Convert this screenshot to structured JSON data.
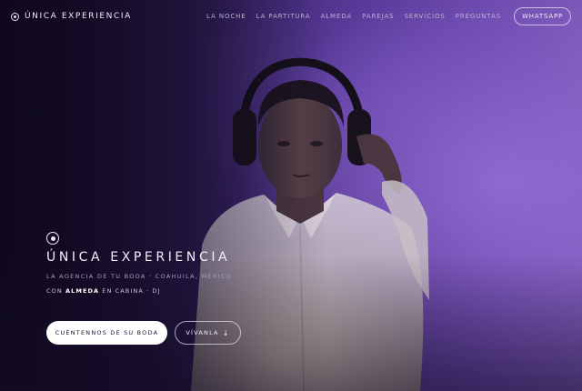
{
  "brand": {
    "name": "ÚNICA EXPERIENCIA",
    "icon": "circle-dot-icon"
  },
  "nav": {
    "items": [
      "LA NOCHE",
      "LA PARTITURA",
      "ALMEDA",
      "PAREJAS",
      "SERVICIOS",
      "PREGUNTAS"
    ],
    "cta": "WHATSAPP"
  },
  "hero": {
    "icon": "circle-dot-icon",
    "title": "ÚNICA EXPERIENCIA",
    "tagline": "LA AGENCIA DE TU BODA · COAHUILA, MÉXICO",
    "dj_prefix": "CON",
    "dj_name": "ALMEDA",
    "dj_suffix": "EN CABINA · DJ",
    "primary_button": "CUÉNTENNOS DE SU BODA",
    "secondary_button": "VÍVANLA",
    "secondary_icon": "arrow-down-icon"
  },
  "colors": {
    "background_dark": "#140c26",
    "background_purple": "#6a48aa",
    "text_light": "#f4f0fa",
    "button_white": "#ffffff"
  }
}
